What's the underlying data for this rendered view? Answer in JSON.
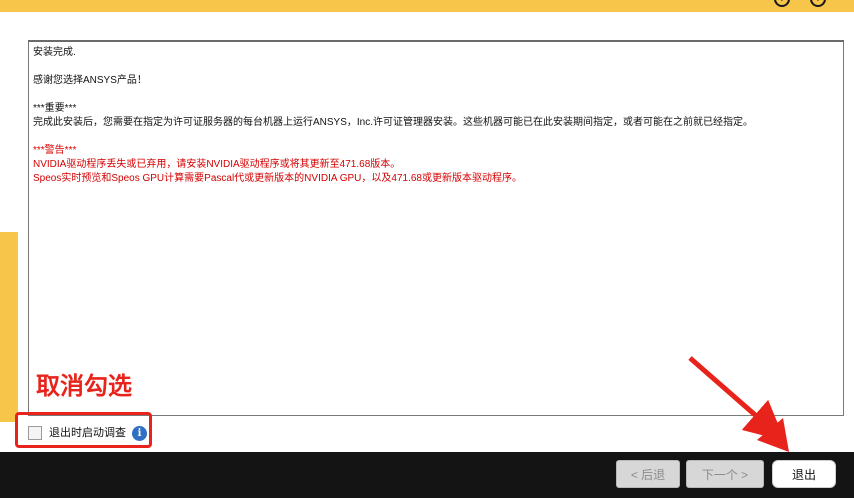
{
  "window": {
    "top_icons": [
      "help-icon",
      "info-icon"
    ]
  },
  "content": {
    "lines": [
      {
        "text": "安装完成.",
        "color": "#111111"
      },
      {
        "text": "",
        "color": "#111111"
      },
      {
        "text": "感谢您选择ANSYS产品！",
        "color": "#111111"
      },
      {
        "text": "",
        "color": "#111111"
      },
      {
        "text": "***重要***",
        "color": "#111111"
      },
      {
        "text": "完成此安装后，您需要在指定为许可证服务器的每台机器上运行ANSYS，Inc.许可证管理器安装。这些机器可能已在此安装期间指定，或者可能在之前就已经指定。",
        "color": "#111111"
      },
      {
        "text": "",
        "color": "#111111"
      },
      {
        "text": "***警告***",
        "color": "#d40000"
      },
      {
        "text": "NVIDIA驱动程序丢失或已弃用，请安装NVIDIA驱动程序或将其更新至471.68版本。",
        "color": "#d40000"
      },
      {
        "text": "Speos实时预览和Speos GPU计算需要Pascal代或更新版本的NVIDIA GPU，以及471.68或更新版本驱动程序。",
        "color": "#d40000"
      }
    ]
  },
  "survey": {
    "checkbox_label": "退出时启动调查",
    "checked": false,
    "info_icon": "info-icon"
  },
  "annotation": {
    "label": "取消勾选",
    "color": "#e8231b"
  },
  "footer": {
    "back_label": "< 后退",
    "next_label": "下一个 >",
    "exit_label": "退出"
  }
}
